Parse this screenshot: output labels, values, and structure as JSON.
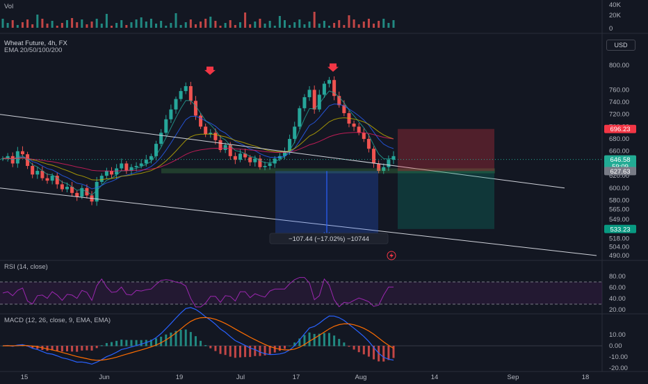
{
  "volume_pane": {
    "label": "Vol",
    "axis_ticks": [
      "40K",
      "20K",
      "0"
    ]
  },
  "main_pane": {
    "symbol_title": "Wheat Future, 4h, FX",
    "indicator_label": "EMA 20/50/100/200",
    "currency": "USD",
    "price_ticks": [
      "800.00",
      "760.00",
      "740.00",
      "720.00",
      "700.00",
      "680.00",
      "660.00",
      "640.00",
      "620.00",
      "600.00",
      "580.00",
      "565.00",
      "549.00",
      "533.00",
      "518.00",
      "504.00",
      "490.00"
    ],
    "price_badges": [
      {
        "value": "696.23",
        "color": "#f23645"
      },
      {
        "value": "646.58",
        "color": "#22ab94"
      },
      {
        "value": "59:09",
        "color": "#22ab94"
      },
      {
        "value": "627.63",
        "color": "#787b86"
      },
      {
        "value": "533.23",
        "color": "#089981"
      }
    ],
    "measure_label": "−107.44 (−17.02%) −10744"
  },
  "rsi_pane": {
    "label": "RSI (14, close)",
    "axis_ticks": [
      "80.00",
      "60.00",
      "40.00",
      "20.00"
    ]
  },
  "macd_pane": {
    "label": "MACD (12, 26, close, 9, EMA, EMA)",
    "axis_ticks": [
      "10.00",
      "0.00",
      "-10.00",
      "-20.00"
    ]
  },
  "time_axis": {
    "labels": [
      "15",
      "Jun",
      "19",
      "Jul",
      "17",
      "Aug",
      "14",
      "Sep",
      "18"
    ]
  },
  "colors": {
    "background": "#131722",
    "candle_up": "#26a69a",
    "candle_down": "#ef5350",
    "rsi_line": "#9c27b0",
    "macd_line": "#2962ff",
    "signal_line": "#ff6d00",
    "stop_zone": "#f23645",
    "target_zone": "#089981",
    "measure_zone": "#2962ff"
  },
  "chart_data": {
    "type": "candlestick",
    "symbol": "Wheat Future",
    "timeframe": "4h",
    "price_close_series": [
      648,
      652,
      640,
      660,
      655,
      636,
      622,
      628,
      616,
      612,
      620,
      606,
      598,
      602,
      592,
      586,
      600,
      588,
      578,
      610,
      620,
      628,
      622,
      632,
      640,
      628,
      634,
      636,
      640,
      646,
      652,
      672,
      690,
      712,
      728,
      745,
      758,
      766,
      742,
      718,
      700,
      688,
      690,
      678,
      662,
      670,
      652,
      646,
      656,
      650,
      642,
      648,
      634,
      636,
      640,
      648,
      652,
      660,
      680,
      700,
      730,
      748,
      760,
      728,
      752,
      770,
      776,
      750,
      735,
      722,
      705,
      700,
      690,
      680,
      664,
      640,
      628,
      634,
      646,
      652
    ],
    "resistance_tops_marked": 2,
    "current_price": 646.58,
    "position_stop": 696.23,
    "position_entry": 627.63,
    "position_target": 533.23,
    "measured_move": {
      "points": -107.44,
      "percent": -17.02,
      "ticks": -10744
    }
  }
}
